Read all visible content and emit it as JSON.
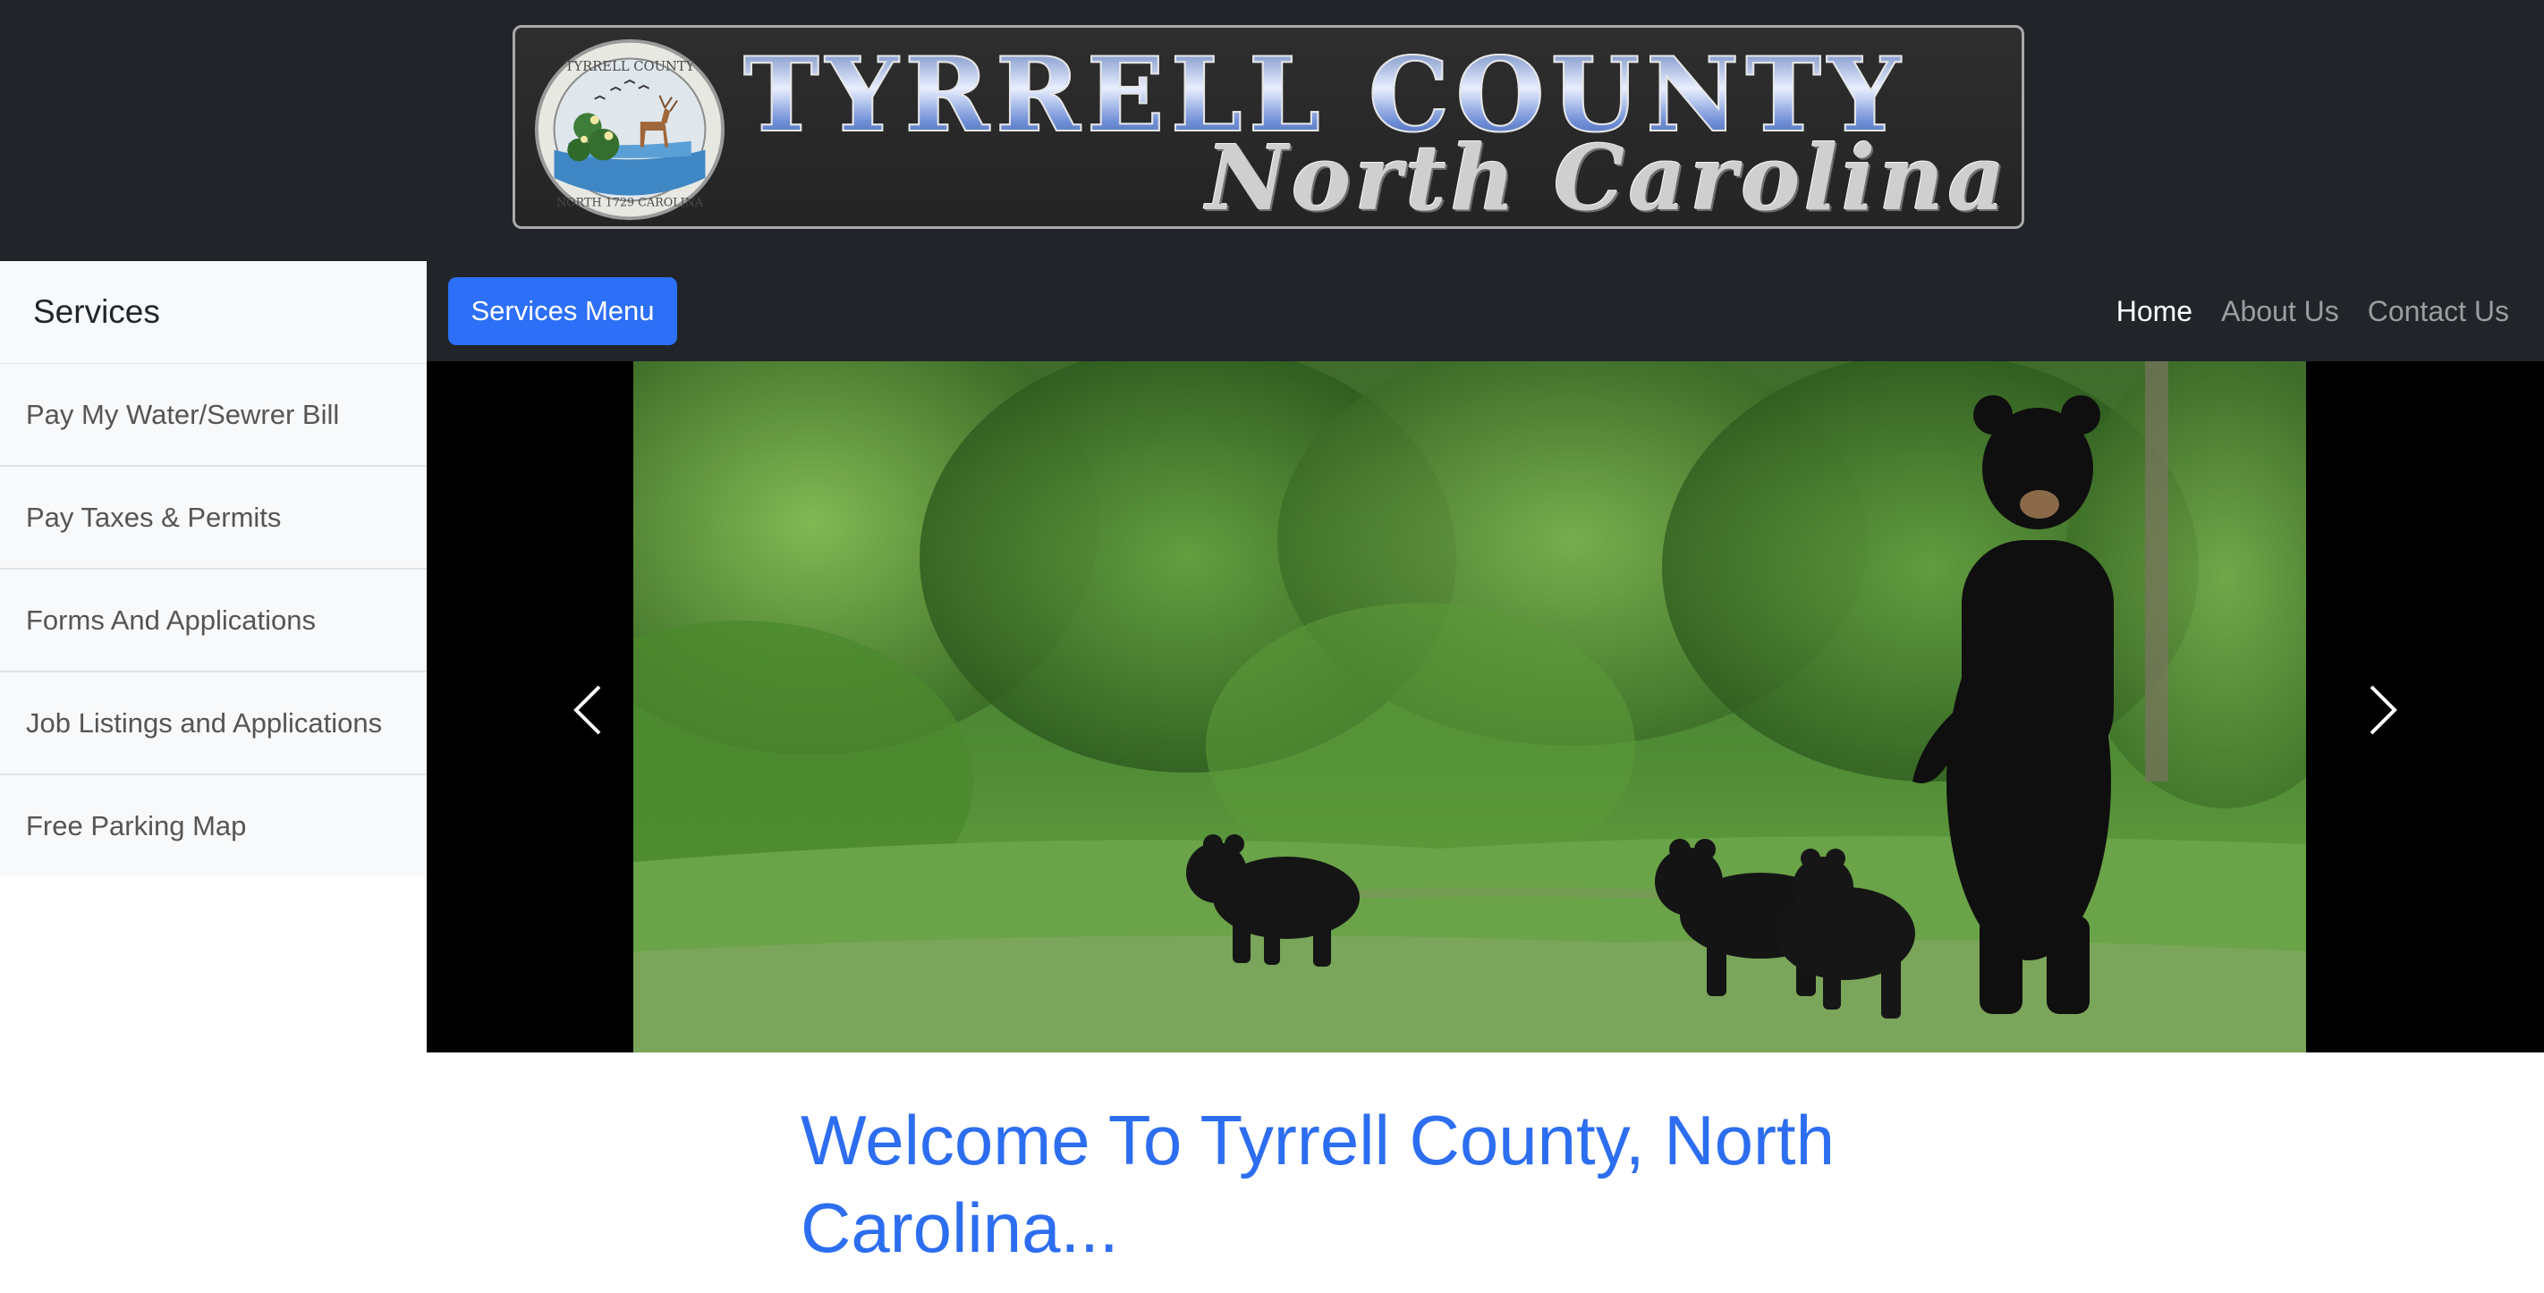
{
  "banner": {
    "title": "TYRRELL COUNTY",
    "subtitle": "North Carolina",
    "seal_text_top": "TYRRELL COUNTY",
    "seal_text_bottom": "NORTH 1729 CAROLINA"
  },
  "sidebar": {
    "heading": "Services",
    "items": [
      {
        "label": "Pay My Water/Sewrer Bill"
      },
      {
        "label": "Pay Taxes & Permits"
      },
      {
        "label": "Forms And Applications"
      },
      {
        "label": "Job Listings and Applications"
      },
      {
        "label": "Free Parking Map"
      }
    ]
  },
  "navbar": {
    "services_button": "Services Menu",
    "links": [
      {
        "label": "Home",
        "active": true
      },
      {
        "label": "About Us",
        "active": false
      },
      {
        "label": "Contact Us",
        "active": false
      }
    ]
  },
  "carousel": {
    "prev_icon": "chevron-left-icon",
    "next_icon": "chevron-right-icon"
  },
  "main": {
    "welcome_heading": "Welcome To Tyrrell County, North Carolina..."
  },
  "colors": {
    "header_bg": "#212529",
    "accent_blue": "#2d6ff7",
    "heading_blue": "#2d6ef0",
    "sidebar_bg": "#f8f9fa"
  }
}
